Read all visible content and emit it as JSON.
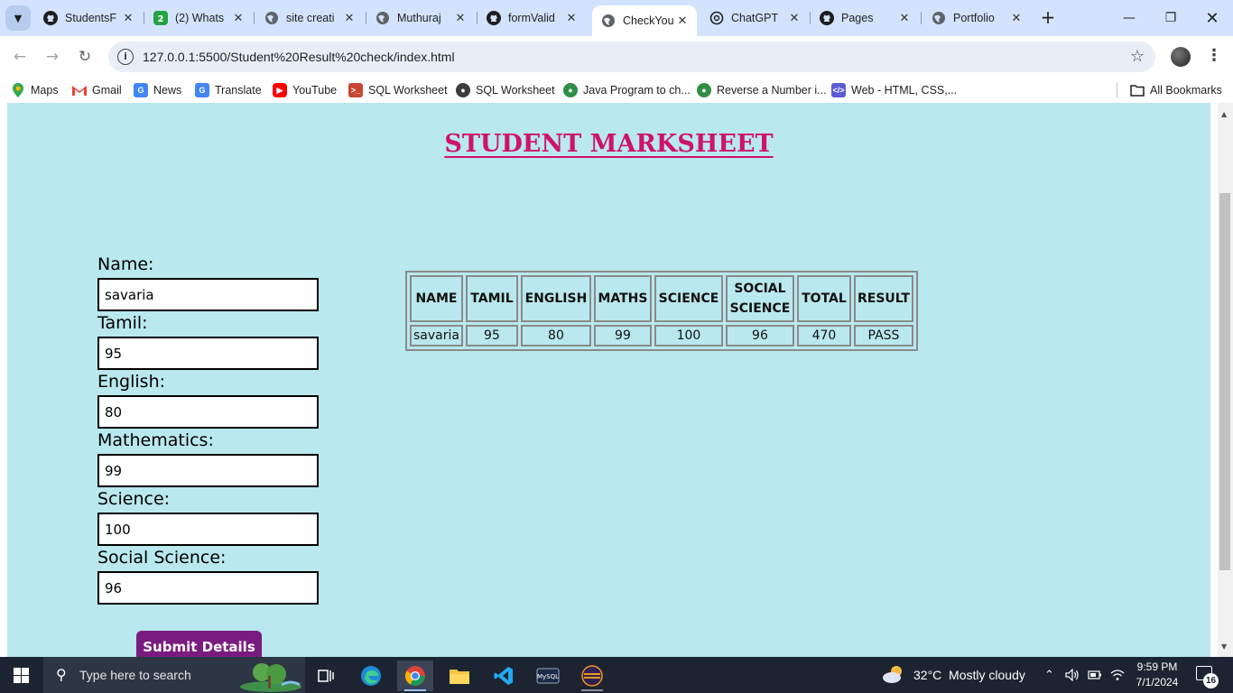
{
  "browser": {
    "tabs": [
      {
        "title": "StudentsF",
        "icon": "github-icon"
      },
      {
        "title": "(2) Whats",
        "icon": "whatsapp-icon",
        "badge": "2"
      },
      {
        "title": "site creati",
        "icon": "globe-icon"
      },
      {
        "title": "Muthuraj",
        "icon": "globe-icon"
      },
      {
        "title": "formValid",
        "icon": "github-icon"
      },
      {
        "title": "CheckYou",
        "icon": "globe-icon",
        "active": true
      },
      {
        "title": "ChatGPT",
        "icon": "chatgpt-icon"
      },
      {
        "title": "Pages",
        "icon": "github-icon"
      },
      {
        "title": "Portfolio",
        "icon": "globe-icon"
      }
    ],
    "url": "127.0.0.1:5500/Student%20Result%20check/index.html",
    "bookmarks": [
      {
        "label": "Maps",
        "icon": "maps-icon"
      },
      {
        "label": "Gmail",
        "icon": "gmail-icon"
      },
      {
        "label": "News",
        "icon": "news-icon"
      },
      {
        "label": "Translate",
        "icon": "translate-icon"
      },
      {
        "label": "YouTube",
        "icon": "youtube-icon"
      },
      {
        "label": "SQL Worksheet",
        "icon": "terminal-icon"
      },
      {
        "label": "SQL Worksheet",
        "icon": "globe-icon"
      },
      {
        "label": "Java Program to ch...",
        "icon": "gfg-icon"
      },
      {
        "label": "Reverse a Number i...",
        "icon": "gfg-icon"
      },
      {
        "label": "Web - HTML, CSS,...",
        "icon": "code-icon"
      }
    ],
    "all_bookmarks": "All Bookmarks",
    "colors": {
      "tabstrip": "#d3e3fd",
      "omnibox": "#e9eef6"
    }
  },
  "page": {
    "heading": "STUDENT MARKSHEET",
    "background": "#b9e8ee",
    "heading_color": "#d0126a",
    "form": {
      "fields": [
        {
          "label": "Name:",
          "value": "savaria"
        },
        {
          "label": "Tamil:",
          "value": "95"
        },
        {
          "label": "English:",
          "value": "80"
        },
        {
          "label": "Mathematics:",
          "value": "99"
        },
        {
          "label": "Science:",
          "value": "100"
        },
        {
          "label": "Social Science:",
          "value": "96"
        }
      ],
      "submit_label": "Submit Details",
      "submit_color": "#7a1b7f"
    },
    "table": {
      "headers": [
        "NAME",
        "TAMIL",
        "ENGLISH",
        "MATHS",
        "SCIENCE",
        "SOCIAL SCIENCE",
        "TOTAL",
        "RESULT"
      ],
      "row": [
        "savaria",
        "95",
        "80",
        "99",
        "100",
        "96",
        "470",
        "PASS"
      ]
    }
  },
  "taskbar": {
    "search_placeholder": "Type here to search",
    "apps": [
      {
        "name": "task-view-icon"
      },
      {
        "name": "edge-icon"
      },
      {
        "name": "chrome-icon",
        "active": true
      },
      {
        "name": "file-explorer-icon"
      },
      {
        "name": "vscode-icon"
      },
      {
        "name": "mysql-icon"
      },
      {
        "name": "eclipse-icon"
      }
    ],
    "weather": "32°C  Mostly cloudy",
    "time": "9:59 PM",
    "date": "7/1/2024",
    "notification_count": "16"
  }
}
